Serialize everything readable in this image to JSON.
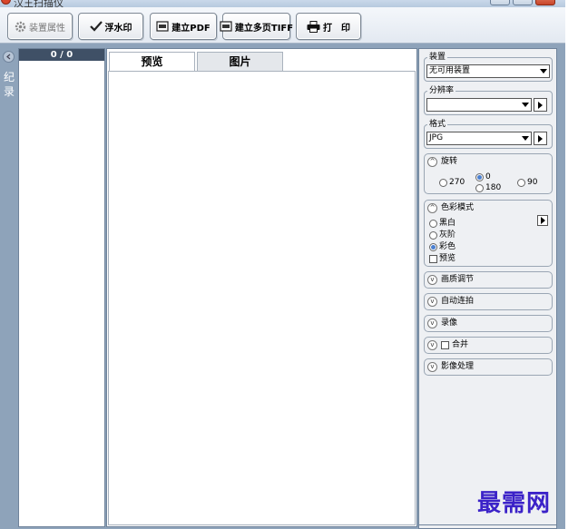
{
  "window": {
    "title": "汉王扫描仪"
  },
  "toolbar": {
    "device_props": "装置属性",
    "watermark": "浮水印",
    "create_pdf": "建立PDF",
    "create_tiff": "建立多页TIFF",
    "print": "打　印"
  },
  "records": {
    "label": "纪录",
    "count": "0 / 0"
  },
  "tabs": {
    "preview": "预览",
    "image": "图片"
  },
  "panel": {
    "device": {
      "legend": "装置",
      "value": "无可用装置"
    },
    "resolution": {
      "legend": "分辨率",
      "value": ""
    },
    "format": {
      "legend": "格式",
      "value": "JPG"
    },
    "rotate": {
      "title": "旋转",
      "options": [
        "270",
        "0",
        "180",
        "90"
      ],
      "selected": "0"
    },
    "color_mode": {
      "title": "色彩模式",
      "options": [
        "黑白",
        "灰阶",
        "彩色"
      ],
      "selected": "彩色",
      "preview_label": "预览"
    },
    "sections": {
      "quality": "画质调节",
      "auto_shoot": "自动连拍",
      "record": "录像",
      "merge": "合并",
      "image_proc": "影像处理"
    }
  },
  "watermark_text": "最需网"
}
